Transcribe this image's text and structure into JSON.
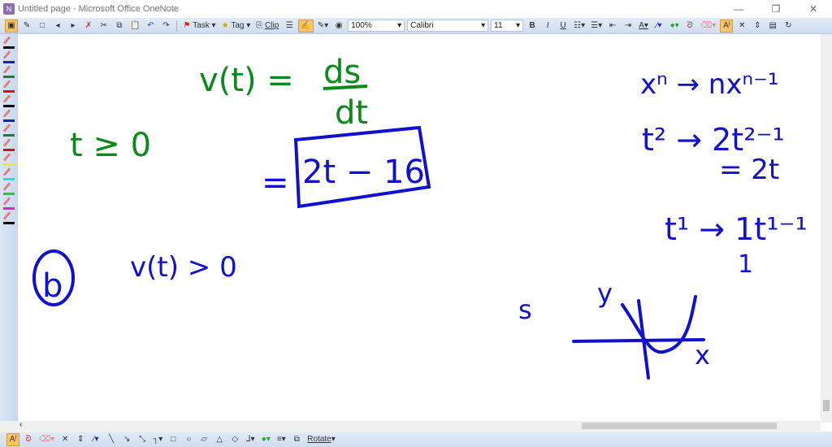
{
  "window": {
    "title": "Untitled page - Microsoft Office OneNote",
    "minimize": "—",
    "restore": "❐",
    "close": "✕"
  },
  "toolbar": {
    "task": "Task",
    "tag": "Tag",
    "clip": "Clip",
    "zoom": "100%",
    "font": "Calibri",
    "size": "11",
    "bold": "B",
    "italic": "I",
    "underline": "U"
  },
  "pens": [
    "#000000",
    "#1a1ad0",
    "#138a13",
    "#e01010",
    "#000000",
    "#1a1ad0",
    "#138a13",
    "#e01010",
    "#f0f000",
    "#20e0f0",
    "#20d020",
    "#e020e0",
    "#000000"
  ],
  "drawbar": {
    "rotate": "Rotate"
  },
  "ink": {
    "green": "#0a8a1a",
    "blue": "#1010d0",
    "v_eq": "v(t) =",
    "ds": "ds",
    "dt": "dt",
    "t_ge": "t ≥ 0",
    "eq": "=",
    "boxed": "2t − 16",
    "b_label": "b",
    "v_gt": "v(t) > 0",
    "r1": "xⁿ → nxⁿ⁻¹",
    "r2": "t² → 2t²⁻¹",
    "r3": "= 2t",
    "r4": "t¹ → 1t¹⁻¹",
    "r5": "1",
    "s": "s",
    "y": "y",
    "x": "x"
  }
}
